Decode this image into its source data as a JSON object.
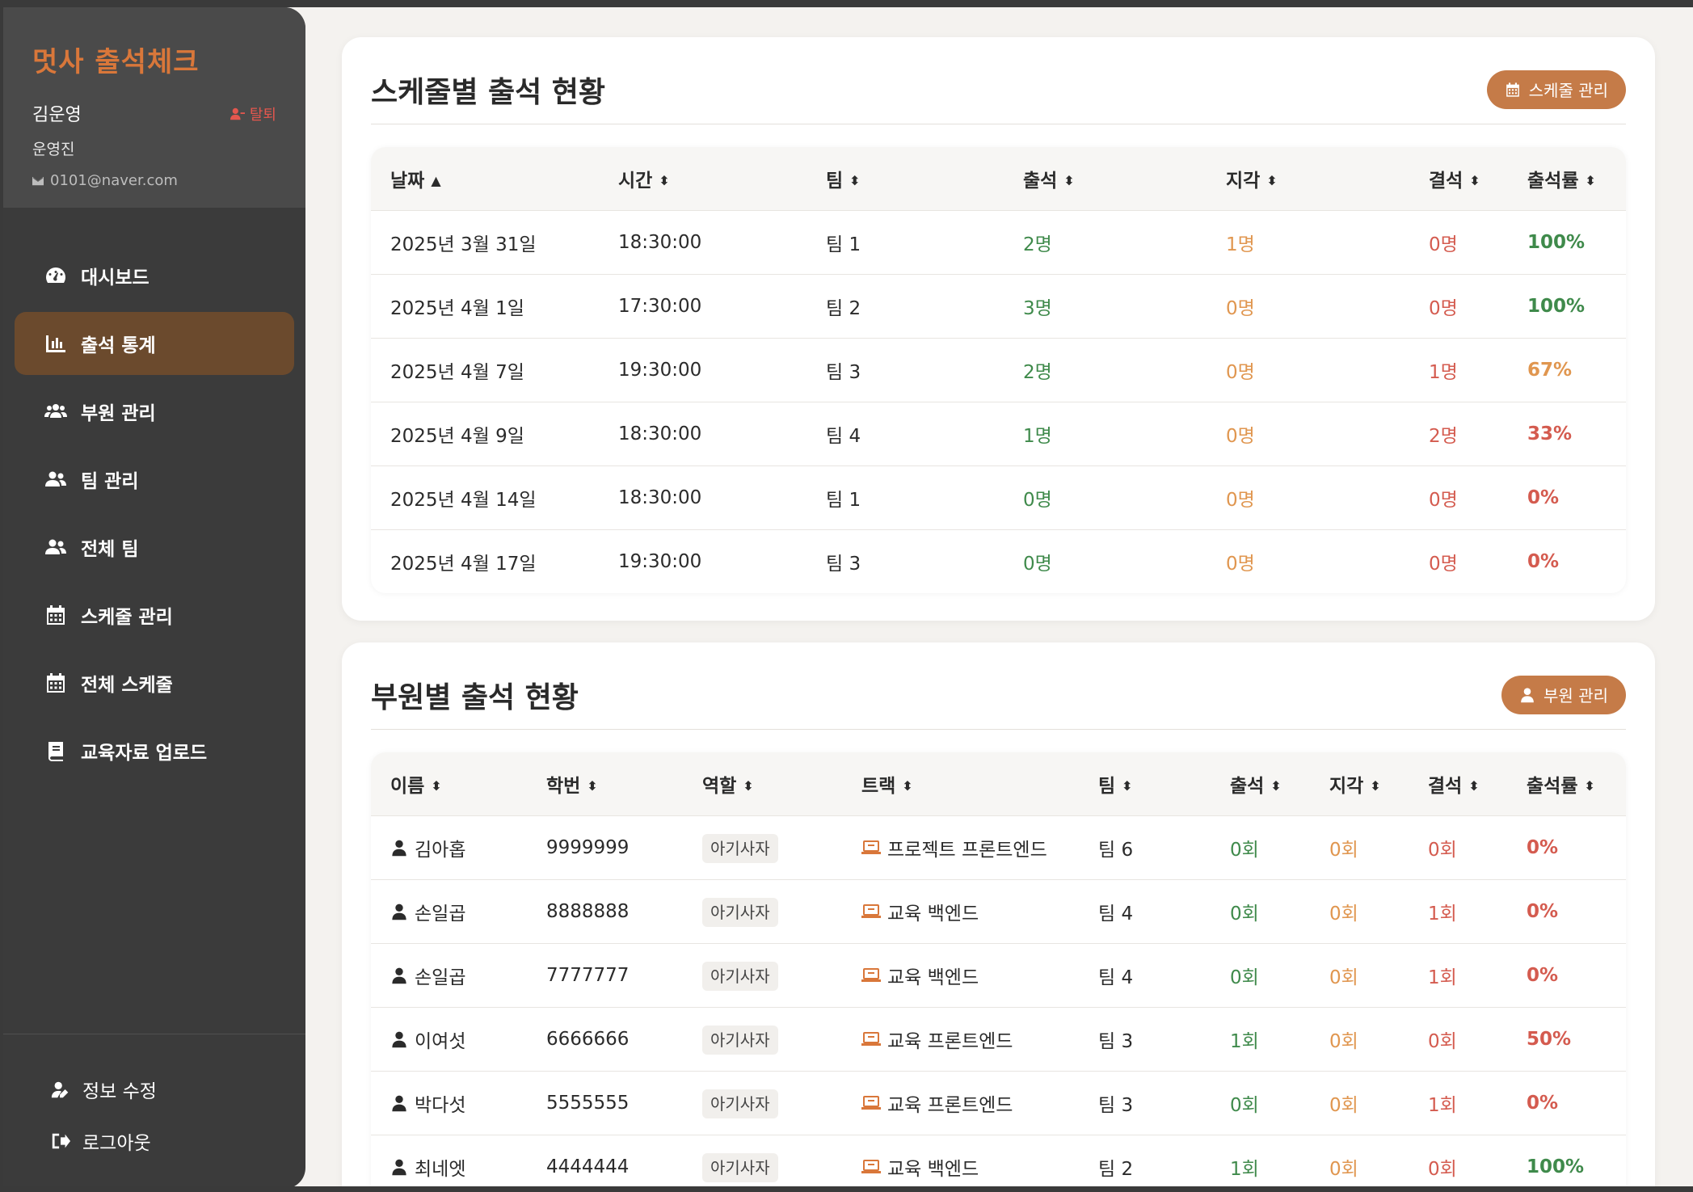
{
  "sidebar": {
    "brand": "멋사 출석체크",
    "user": {
      "name": "김운영",
      "role": "운영진",
      "email": "0101@naver.com",
      "withdraw_label": "탈퇴"
    },
    "nav": [
      {
        "label": "대시보드",
        "icon": "gauge-icon",
        "active": false
      },
      {
        "label": "출석 통계",
        "icon": "bar-chart-icon",
        "active": true
      },
      {
        "label": "부원 관리",
        "icon": "users-icon",
        "active": false
      },
      {
        "label": "팀 관리",
        "icon": "user-pair-icon",
        "active": false
      },
      {
        "label": "전체 팀",
        "icon": "user-pair-icon",
        "active": false
      },
      {
        "label": "스케줄 관리",
        "icon": "calendar-icon",
        "active": false
      },
      {
        "label": "전체 스케줄",
        "icon": "calendar-icon",
        "active": false
      },
      {
        "label": "교육자료 업로드",
        "icon": "book-icon",
        "active": false
      }
    ],
    "footer": [
      {
        "label": "정보 수정",
        "icon": "user-edit-icon"
      },
      {
        "label": "로그아웃",
        "icon": "logout-icon"
      }
    ]
  },
  "schedule_section": {
    "title": "스케줄별 출석 현황",
    "button_label": "스케줄 관리",
    "columns": [
      "날짜",
      "시간",
      "팀",
      "출석",
      "지각",
      "결석",
      "출석률"
    ],
    "rows": [
      [
        "2025년 3월 31일",
        "18:30:00",
        "팀 1",
        "2명",
        "1명",
        "0명",
        "100%"
      ],
      [
        "2025년 4월 1일",
        "17:30:00",
        "팀 2",
        "3명",
        "0명",
        "0명",
        "100%"
      ],
      [
        "2025년 4월 7일",
        "19:30:00",
        "팀 3",
        "2명",
        "0명",
        "1명",
        "67%"
      ],
      [
        "2025년 4월 9일",
        "18:30:00",
        "팀 4",
        "1명",
        "0명",
        "2명",
        "33%"
      ],
      [
        "2025년 4월 14일",
        "18:30:00",
        "팀 1",
        "0명",
        "0명",
        "0명",
        "0%"
      ],
      [
        "2025년 4월 17일",
        "19:30:00",
        "팀 3",
        "0명",
        "0명",
        "0명",
        "0%"
      ]
    ]
  },
  "member_section": {
    "title": "부원별 출석 현황",
    "button_label": "부원 관리",
    "columns": [
      "이름",
      "학번",
      "역할",
      "트랙",
      "팀",
      "출석",
      "지각",
      "결석",
      "출석률"
    ],
    "rows": [
      [
        "김아홉",
        "9999999",
        "아기사자",
        "프로젝트 프론트엔드",
        "팀 6",
        "0회",
        "0회",
        "0회",
        "0%"
      ],
      [
        "손일곱",
        "8888888",
        "아기사자",
        "교육 백엔드",
        "팀 4",
        "0회",
        "0회",
        "1회",
        "0%"
      ],
      [
        "손일곱",
        "7777777",
        "아기사자",
        "교육 백엔드",
        "팀 4",
        "0회",
        "0회",
        "1회",
        "0%"
      ],
      [
        "이여섯",
        "6666666",
        "아기사자",
        "교육 프론트엔드",
        "팀 3",
        "1회",
        "0회",
        "0회",
        "50%"
      ],
      [
        "박다섯",
        "5555555",
        "아기사자",
        "교육 프론트엔드",
        "팀 3",
        "0회",
        "0회",
        "1회",
        "0%"
      ],
      [
        "최네엣",
        "4444444",
        "아기사자",
        "교육 백엔드",
        "팀 2",
        "1회",
        "0회",
        "0회",
        "100%"
      ]
    ]
  },
  "colors": {
    "accent": "#c57b48",
    "brand": "#d9773a",
    "sidebar_bg": "#3b3b3b",
    "active_nav": "#6b4a2d",
    "present": "#3f8a4b",
    "late": "#e0964f",
    "absent": "#d45b4f"
  }
}
